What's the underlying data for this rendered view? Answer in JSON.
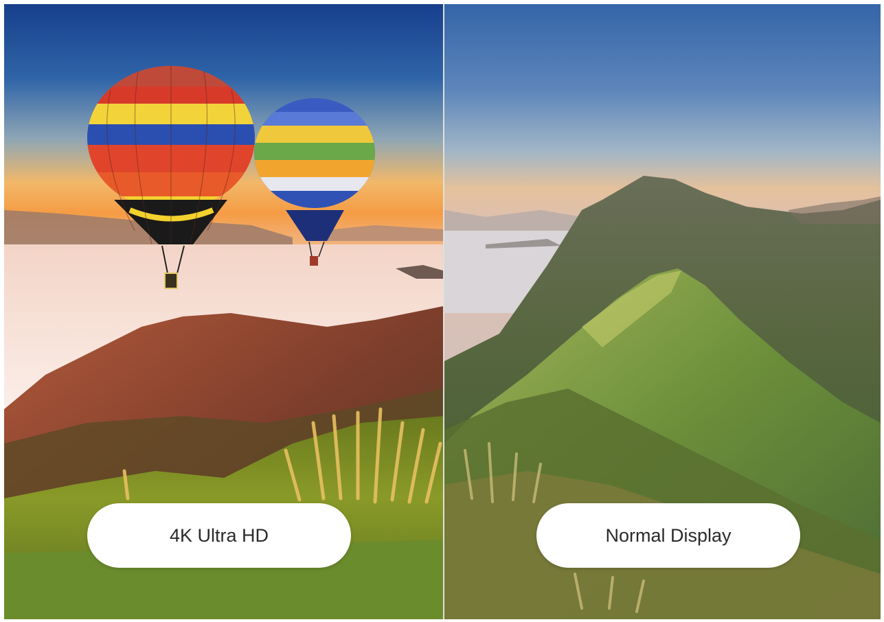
{
  "labels": {
    "left": "4K Ultra HD",
    "right": "Normal Display"
  },
  "colors": {
    "left_sky_top": "#1f4f9a",
    "left_sky_horizon": "#f5a24a",
    "right_sky_top": "#3a6aa8",
    "right_sky_horizon": "#e9b98e",
    "pill_background": "#ffffff",
    "pill_text": "#2a2a2a"
  },
  "icons": {
    "balloon_large": "hot-air-balloon-icon",
    "balloon_small": "hot-air-balloon-icon"
  }
}
